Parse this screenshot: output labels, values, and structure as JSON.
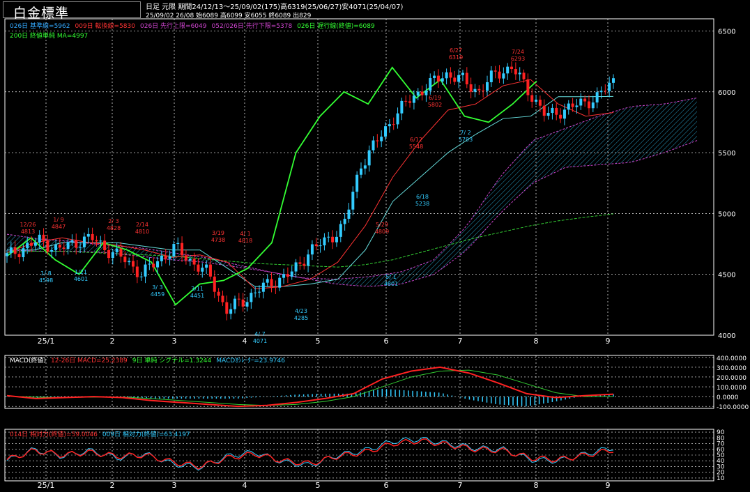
{
  "header": {
    "instrument": "白金標準",
    "info_line1": "日足 元限 期間24/12/13～25/09/02(175)高6319(25/06/27)安4071(25/04/07)",
    "info_line2": "25/09/02 26/08 始6089 高6099 安6055 終6089 出829"
  },
  "legends": {
    "main": [
      {
        "text": "026日 基準線=5962",
        "color": "#33aaff"
      },
      {
        "text": "009日 転換線=5830",
        "color": "#ff3333"
      },
      {
        "text": "026日 先行上限=6049",
        "color": "#cc44cc"
      },
      {
        "text": "052/026日 先行下限=5378",
        "color": "#cc44cc"
      },
      {
        "text": "026日 遅行線(終値)=6089",
        "color": "#33ff33"
      }
    ],
    "main2": [
      {
        "text": "200日 終値単純 MA=4997",
        "color": "#33ff33"
      }
    ],
    "macd": [
      {
        "text": "MACD(終値)",
        "color": "#ffffff"
      },
      {
        "text": "12-26日 MACD=25.2389",
        "color": "#ff3333"
      },
      {
        "text": "9日 単純 シグナル=1.3244",
        "color": "#33ff33"
      },
      {
        "text": "MACDｵｼﾚｰﾀｰ=23.9746",
        "color": "#33ccff"
      }
    ],
    "rsi": [
      {
        "text": "014日 相対力(終値)=59.0046",
        "color": "#ff3333"
      },
      {
        "text": "009日 相対力(終値)=63.4197",
        "color": "#33ccff"
      }
    ]
  },
  "colors": {
    "up": "#33ccff",
    "down": "#ff2222",
    "lagging": "#33ff33",
    "ma200": "#33cc33",
    "kumo": "#cc44cc",
    "kumo_fill": "#33ccff",
    "tenkan": "#ff3333",
    "kijun": "#66dddd",
    "grid": "#ffffff",
    "axis_text": "#ffffff"
  },
  "chart_data": [
    {
      "type": "candlestick",
      "title": "白金標準",
      "x_tick_labels": [
        "25/1",
        "2",
        "3",
        "4",
        "5",
        "6",
        "7",
        "8",
        "9"
      ],
      "ylim": [
        4000,
        6600
      ],
      "y_ticks": [
        4000,
        4500,
        5000,
        5500,
        6000,
        6500
      ],
      "grid": true,
      "series": [
        {
          "name": "026日 基準線",
          "values": [
            4700,
            4700,
            4760,
            4760,
            4760,
            4730,
            4700,
            4700,
            4550,
            4400,
            4400,
            4420,
            4460,
            4700,
            5100,
            5300,
            5500,
            5650,
            5780,
            5800,
            5960,
            5960,
            5962
          ]
        },
        {
          "name": "009日 転換線",
          "values": [
            4680,
            4760,
            4800,
            4760,
            4740,
            4700,
            4640,
            4660,
            4600,
            4380,
            4400,
            4460,
            4600,
            4900,
            5300,
            5600,
            5850,
            5900,
            6050,
            6100,
            5900,
            5800,
            5830
          ]
        },
        {
          "name": "026日 遅行線(終値)",
          "values": [
            4650,
            4800,
            4620,
            4500,
            4760,
            4700,
            4600,
            4250,
            4420,
            4450,
            4550,
            4760,
            5500,
            5800,
            6000,
            5900,
            6200,
            5950,
            6100,
            5800,
            5750,
            5900,
            6089
          ]
        },
        {
          "name": "200日 終値単純 MA",
          "values": [
            4680,
            4690,
            4690,
            4680,
            4670,
            4660,
            4650,
            4630,
            4610,
            4590,
            4580,
            4570,
            4560,
            4580,
            4620,
            4680,
            4740,
            4800,
            4850,
            4900,
            4940,
            4970,
            4997
          ]
        }
      ],
      "annotations": [
        {
          "label": "12/26",
          "value": "4813"
        },
        {
          "label": "1/ 8",
          "value": "4598"
        },
        {
          "label": "1/ 9",
          "value": "4847"
        },
        {
          "label": "1/21",
          "value": "4601"
        },
        {
          "label": "2/ 3",
          "value": "4828"
        },
        {
          "label": "2/14",
          "value": "4810"
        },
        {
          "label": "3/ 3",
          "value": "4459"
        },
        {
          "label": "3/11",
          "value": "4451"
        },
        {
          "label": "3/19",
          "value": "4738"
        },
        {
          "label": "4/ 1",
          "value": "4818"
        },
        {
          "label": "4/ 7",
          "value": "4071"
        },
        {
          "label": "4/23",
          "value": "4285"
        },
        {
          "label": "5/ 1",
          "value": "4801"
        },
        {
          "label": "5/29",
          "value": "4809"
        },
        {
          "label": "6/12",
          "value": "5548"
        },
        {
          "label": "6/18",
          "value": "5238"
        },
        {
          "label": "6/27",
          "value": "6319"
        },
        {
          "label": "6/19",
          "value": "5802"
        },
        {
          "label": "7/ 2",
          "value": "5793"
        },
        {
          "label": "7/24",
          "value": "6293"
        }
      ]
    },
    {
      "type": "bar",
      "title": "MACD(終値)",
      "y_tick_labels": [
        "400.0000",
        "300.0000",
        "200.0000",
        "100.0000",
        "0.0000",
        "-100.0000"
      ],
      "ylim": [
        -120,
        420
      ],
      "series": [
        {
          "name": "12-26日 MACD",
          "values": [
            10,
            -20,
            -10,
            0,
            -10,
            -40,
            -60,
            -80,
            -100,
            -90,
            -60,
            -20,
            30,
            180,
            260,
            300,
            240,
            140,
            30,
            -10,
            10,
            25
          ]
        },
        {
          "name": "9日 単純 シグナル",
          "values": [
            5,
            -5,
            -10,
            -5,
            -5,
            -20,
            -40,
            -60,
            -80,
            -90,
            -80,
            -50,
            0,
            100,
            200,
            260,
            270,
            220,
            130,
            40,
            0,
            1
          ]
        },
        {
          "name": "MACDｵｼﾚｰﾀｰ",
          "values": [
            5,
            -15,
            0,
            5,
            -5,
            -20,
            -20,
            -20,
            -20,
            0,
            20,
            30,
            30,
            80,
            60,
            40,
            -30,
            -80,
            -100,
            -50,
            10,
            24
          ]
        }
      ]
    },
    {
      "type": "line",
      "title": "相対力",
      "y_tick_labels": [
        "90",
        "80",
        "70",
        "60",
        "50",
        "40",
        "30",
        "20",
        "10"
      ],
      "ylim": [
        5,
        95
      ],
      "series": [
        {
          "name": "014日 相対力(終値)",
          "values": [
            42,
            58,
            50,
            55,
            48,
            50,
            38,
            30,
            45,
            52,
            40,
            35,
            48,
            55,
            70,
            75,
            68,
            60,
            58,
            45,
            42,
            50,
            59
          ]
        },
        {
          "name": "009日 相対力(終値)",
          "values": [
            40,
            60,
            48,
            58,
            45,
            52,
            35,
            28,
            48,
            55,
            38,
            32,
            50,
            58,
            74,
            78,
            70,
            62,
            60,
            42,
            40,
            52,
            63
          ]
        }
      ]
    }
  ]
}
